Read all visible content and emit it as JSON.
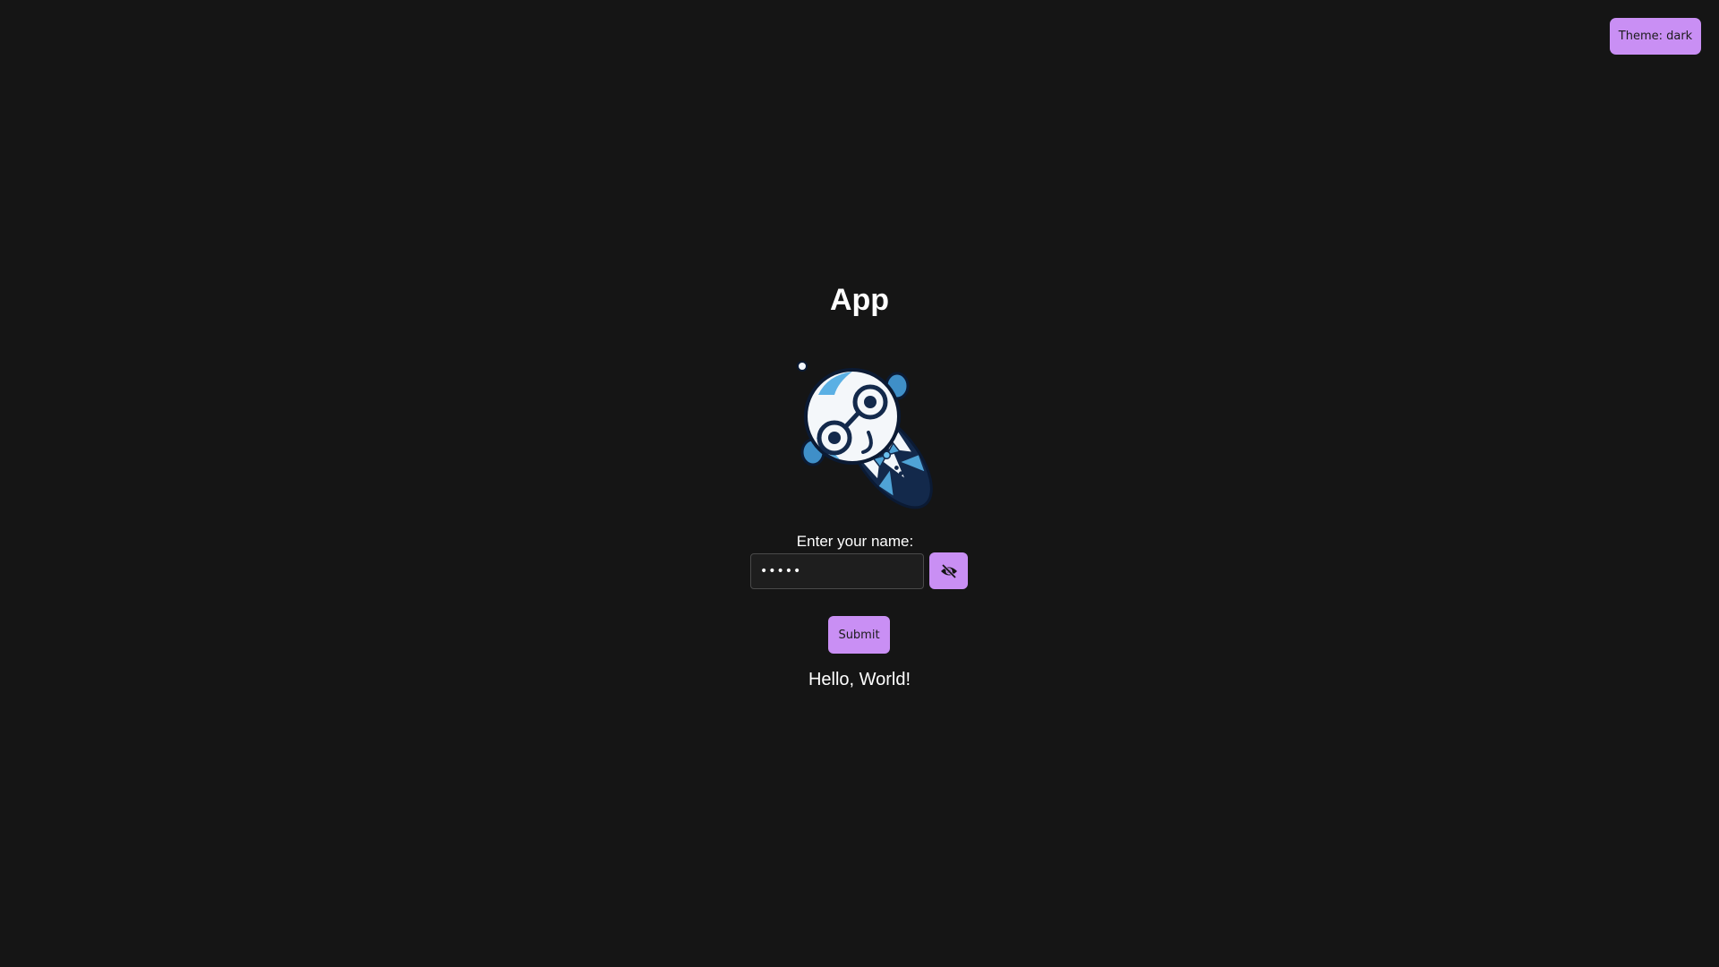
{
  "theme_toggle": {
    "label": "Theme: dark"
  },
  "app": {
    "title": "App"
  },
  "form": {
    "label": "Enter your name:",
    "input_value": "World",
    "input_type": "password",
    "visibility_icon": "eye-off-icon",
    "submit_label": "Submit"
  },
  "greeting": "Hello, World!",
  "mascot": {
    "icon": "mascot-icon"
  },
  "colors": {
    "background": "#151515",
    "accent": "#c98ff4",
    "text": "#ffffff",
    "input_bg": "#1e1e1e",
    "input_border": "#4a4a4a"
  }
}
